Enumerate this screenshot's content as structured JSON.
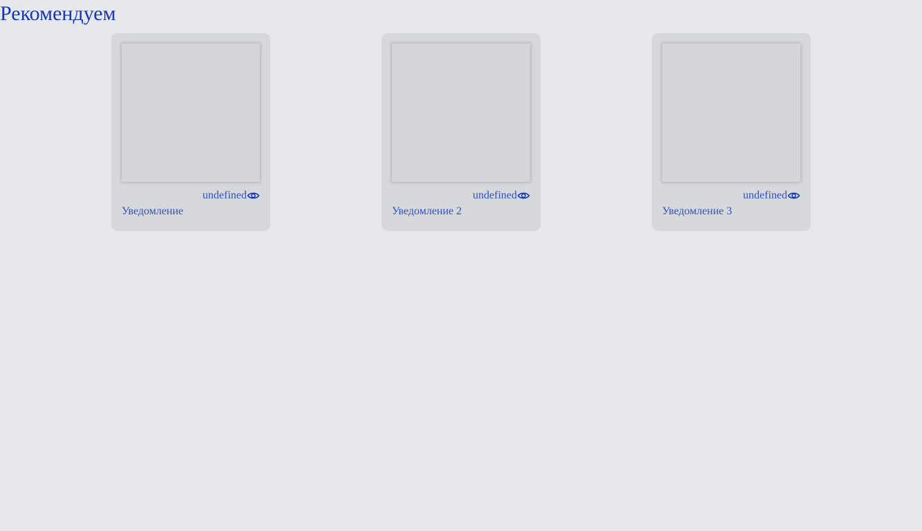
{
  "page": {
    "title": "Рекомендуем"
  },
  "cards": [
    {
      "views": "undefined",
      "title": "Уведомление",
      "view_icon": "eye-icon"
    },
    {
      "views": "undefined",
      "title": "Уведомление 2",
      "view_icon": "eye-icon"
    },
    {
      "views": "undefined",
      "title": "Уведомление 3",
      "view_icon": "eye-icon"
    }
  ],
  "colors": {
    "background": "#e7e8eb",
    "card": "#d7d8db",
    "accent": "#2f52c2",
    "title": "#1637b8"
  }
}
